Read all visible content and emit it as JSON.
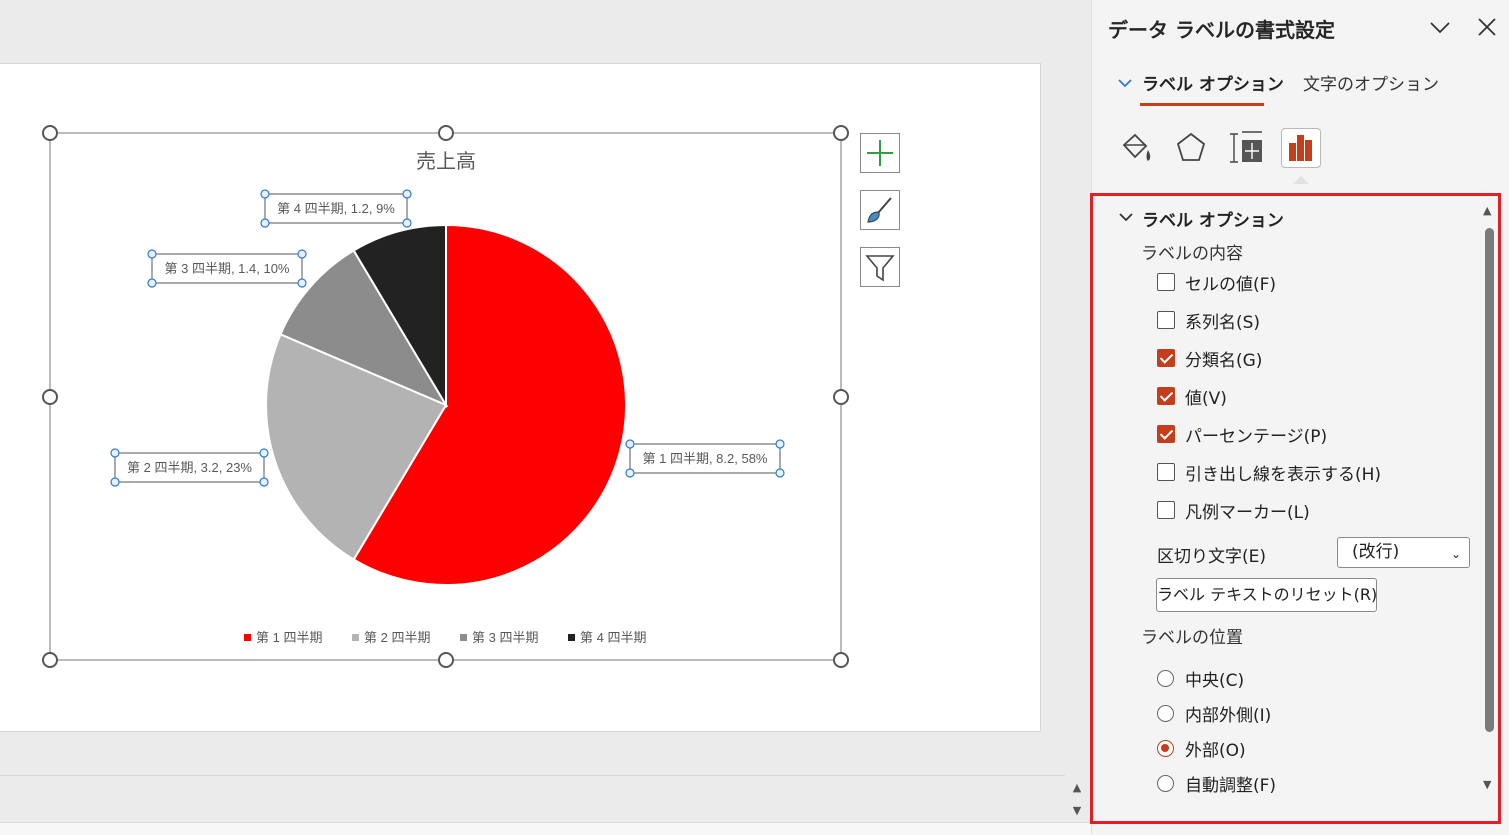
{
  "pane": {
    "title": "データ ラベルの書式設定",
    "tabs": {
      "label_options": "ラベル オプション",
      "text_options": "文字のオプション"
    },
    "section_title": "ラベル オプション",
    "contents_heading": "ラベルの内容",
    "checkboxes": [
      {
        "label": "セルの値(F)",
        "checked": false
      },
      {
        "label": "系列名(S)",
        "checked": false
      },
      {
        "label": "分類名(G)",
        "checked": true
      },
      {
        "label": "値(V)",
        "checked": true
      },
      {
        "label": "パーセンテージ(P)",
        "checked": true
      },
      {
        "label": "引き出し線を表示する(H)",
        "checked": false
      },
      {
        "label": "凡例マーカー(L)",
        "checked": false
      }
    ],
    "separator_label": "区切り文字(E)",
    "separator_value": "(改行)",
    "reset_button": "ラベル テキストのリセット(R)",
    "position_heading": "ラベルの位置",
    "positions": [
      {
        "label": "中央(C)",
        "selected": false
      },
      {
        "label": "内部外側(I)",
        "selected": false
      },
      {
        "label": "外部(O)",
        "selected": true
      },
      {
        "label": "自動調整(F)",
        "selected": false
      }
    ],
    "accent_color": "#c43e1c",
    "highlight_color": "#e21f26",
    "icons": [
      "fill-line-icon",
      "effects-icon",
      "size-properties-icon",
      "label-options-icon"
    ]
  },
  "chart_data": {
    "type": "pie",
    "title": "売上高",
    "categories": [
      "第 1 四半期",
      "第 2 四半期",
      "第 3 四半期",
      "第 4 四半期"
    ],
    "values": [
      8.2,
      3.2,
      1.4,
      1.2
    ],
    "percentages": [
      "58%",
      "23%",
      "10%",
      "9%"
    ],
    "data_labels": [
      "第 1 四半期, 8.2, 58%",
      "第 2 四半期, 3.2, 23%",
      "第 3 四半期, 1.4, 10%",
      "第 4 四半期, 1.2, 9%"
    ],
    "colors": [
      "#ff0000",
      "#b3b3b3",
      "#8c8c8c",
      "#222222"
    ],
    "legend_position": "bottom",
    "start_angle_deg": 0,
    "direction": "clockwise"
  },
  "chart_tools": [
    "chart-elements-icon",
    "chart-styles-icon",
    "chart-filters-icon"
  ]
}
